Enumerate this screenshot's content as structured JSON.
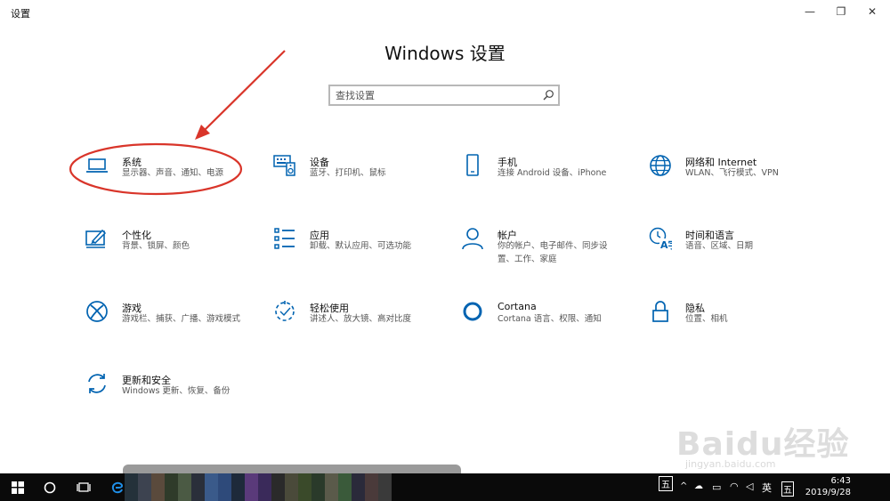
{
  "window": {
    "title": "设置",
    "minimize": "—",
    "restore": "❐",
    "close": "✕"
  },
  "heading": "Windows 设置",
  "search": {
    "placeholder": "查找设置",
    "icon": "search-icon"
  },
  "accent_color": "#0063b1",
  "annotation_color": "#d9352a",
  "tiles": [
    {
      "id": "system",
      "icon": "laptop-icon",
      "title": "系统",
      "sub": [
        "显示器、声音、通知、电源"
      ]
    },
    {
      "id": "devices",
      "icon": "keyboard-speaker-icon",
      "title": "设备",
      "sub": [
        "蓝牙、打印机、鼠标"
      ]
    },
    {
      "id": "phone",
      "icon": "phone-icon",
      "title": "手机",
      "sub": [
        "连接 Android 设备、iPhone"
      ]
    },
    {
      "id": "network",
      "icon": "globe-icon",
      "title": "网络和 Internet",
      "sub": [
        "WLAN、飞行模式、VPN"
      ]
    },
    {
      "id": "personalization",
      "icon": "paint-icon",
      "title": "个性化",
      "sub": [
        "背景、锁屏、颜色"
      ]
    },
    {
      "id": "apps",
      "icon": "apps-list-icon",
      "title": "应用",
      "sub": [
        "卸载、默认应用、可选功能"
      ]
    },
    {
      "id": "accounts",
      "icon": "person-icon",
      "title": "帐户",
      "sub": [
        "你的帐户、电子邮件、同步设",
        "置、工作、家庭"
      ]
    },
    {
      "id": "time-language",
      "icon": "time-language-icon",
      "title": "时间和语言",
      "sub": [
        "语音、区域、日期"
      ]
    },
    {
      "id": "gaming",
      "icon": "xbox-icon",
      "title": "游戏",
      "sub": [
        "游戏栏、捕获、广播、游戏模式"
      ]
    },
    {
      "id": "ease-of-access",
      "icon": "ease-of-access-icon",
      "title": "轻松使用",
      "sub": [
        "讲述人、放大镜、高对比度"
      ]
    },
    {
      "id": "cortana",
      "icon": "cortana-ring-icon",
      "title": "Cortana",
      "sub": [
        "Cortana 语言、权限、通知"
      ]
    },
    {
      "id": "privacy",
      "icon": "lock-icon",
      "title": "隐私",
      "sub": [
        "位置、相机"
      ]
    },
    {
      "id": "update-security",
      "icon": "sync-arrows-icon",
      "title": "更新和安全",
      "sub": [
        "Windows 更新、恢复、备份"
      ]
    }
  ],
  "taskbar": {
    "ime_box": "五",
    "lang": "英",
    "ime_tray": "五",
    "time": "6:43",
    "date": "2019/9/28"
  },
  "watermark": {
    "text": "Baidu经验",
    "sub": "jingyan.baidu.com"
  }
}
